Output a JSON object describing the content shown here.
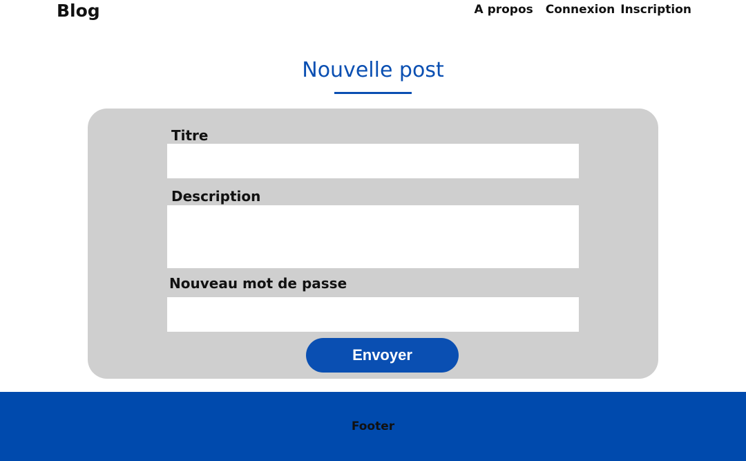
{
  "header": {
    "brand": "Blog",
    "nav": [
      "A propos",
      "Connexion",
      "Inscription"
    ]
  },
  "main": {
    "title": "Nouvelle post",
    "form": {
      "titre_label": "Titre",
      "titre_value": "",
      "description_label": "Description",
      "description_value": "",
      "password_label": "Nouveau mot de passe",
      "password_value": "",
      "submit_label": "Envoyer"
    }
  },
  "footer": {
    "text": "Footer"
  },
  "colors": {
    "accent": "#0a4fb2",
    "footer_bg": "#004aad",
    "card_bg": "#cfcfcf"
  }
}
